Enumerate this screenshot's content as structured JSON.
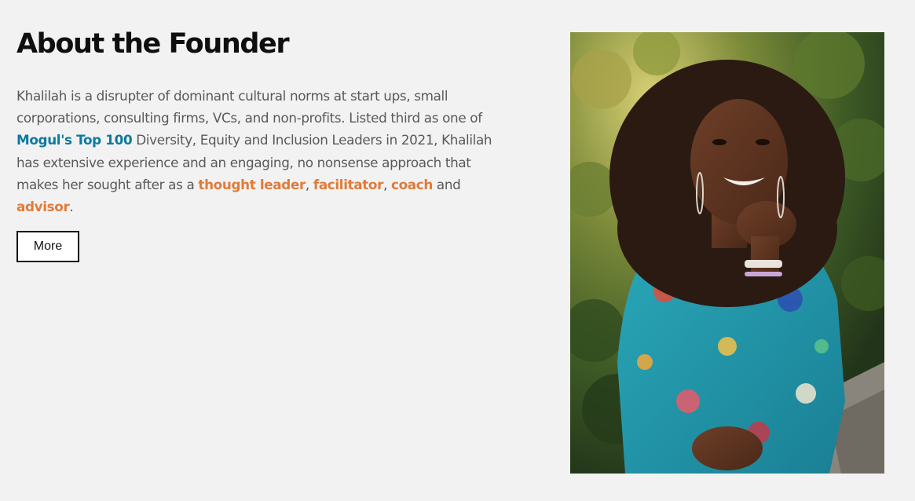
{
  "about": {
    "title": "About the Founder",
    "bio": {
      "part1": "Khalilah is a disrupter of dominant cultural norms at start ups, small corporations, consulting firms, VCs, and non-profits. Listed third as one of ",
      "mogul_link": "Mogul's Top 100",
      "part2": " Diversity, Equity and Inclusion Leaders in 2021, Khalilah has extensive experience and an engaging, no nonsense approach that makes her sought after as a ",
      "thought_leader": "thought leader",
      "sep1": ", ",
      "facilitator": "facilitator",
      "sep2": ", ",
      "coach": "coach",
      "and_text": " and ",
      "advisor": "advisor",
      "end": "."
    },
    "more_label": "More"
  },
  "colors": {
    "background": "#f2f2f2",
    "heading": "#0f0f0f",
    "body_text": "#595959",
    "link_blue": "#0c7a9e",
    "accent_orange": "#e07b39"
  }
}
